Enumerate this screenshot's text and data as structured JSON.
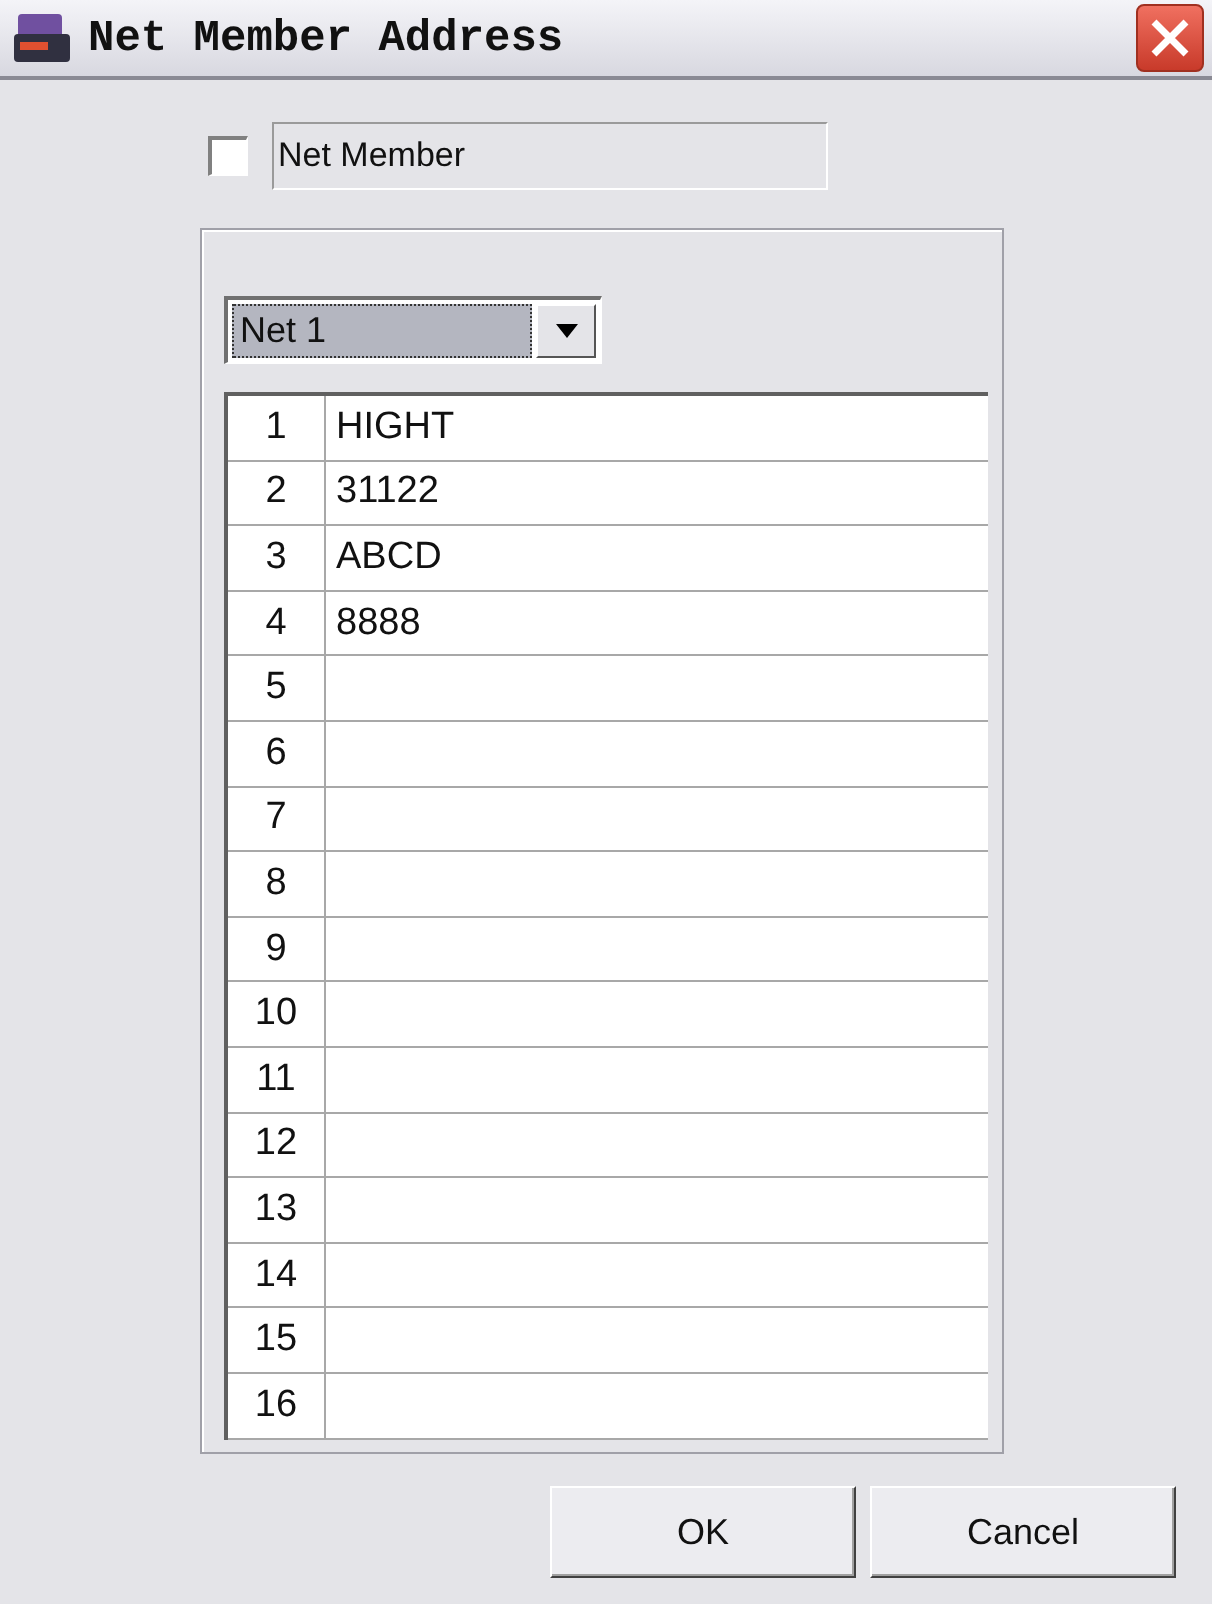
{
  "window": {
    "title": "Net Member Address"
  },
  "net_member": {
    "label": "Net Member",
    "checked": false
  },
  "net_select": {
    "value": "Net 1"
  },
  "members": [
    {
      "index": "1",
      "name": "HIGHT"
    },
    {
      "index": "2",
      "name": "31122"
    },
    {
      "index": "3",
      "name": "ABCD"
    },
    {
      "index": "4",
      "name": "8888"
    },
    {
      "index": "5"
    },
    {
      "index": "6"
    },
    {
      "index": "7"
    },
    {
      "index": "8"
    },
    {
      "index": "9"
    },
    {
      "index": "10"
    },
    {
      "index": "11"
    },
    {
      "index": "12"
    },
    {
      "index": "13"
    },
    {
      "index": "14"
    },
    {
      "index": "15"
    },
    {
      "index": "16"
    }
  ],
  "buttons": [
    "OK",
    "Cancel"
  ]
}
